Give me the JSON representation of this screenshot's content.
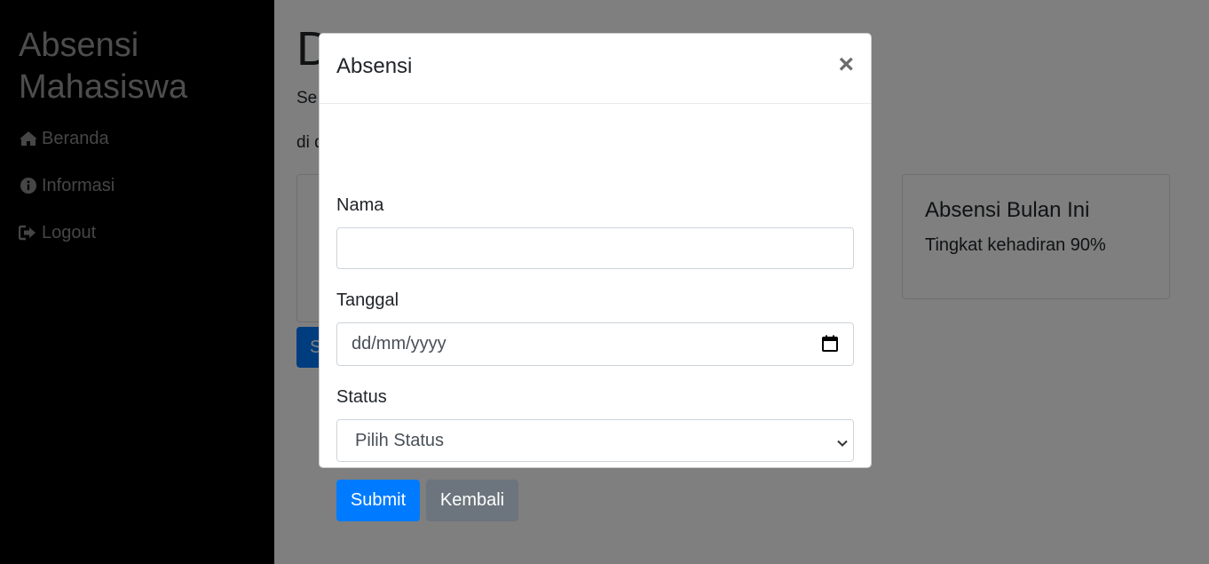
{
  "sidebar": {
    "brand": "Absensi Mahasiswa",
    "items": [
      {
        "label": "Beranda",
        "icon": "home-icon"
      },
      {
        "label": "Informasi",
        "icon": "info-circle-icon"
      },
      {
        "label": "Logout",
        "icon": "sign-out-icon"
      }
    ]
  },
  "main": {
    "title_visible": "D",
    "line1_visible": "Se",
    "line2_visible": "di d",
    "button_visible": "S",
    "card_right": {
      "title": "Absensi Bulan Ini",
      "text": "Tingkat kehadiran 90%"
    }
  },
  "modal": {
    "title": "Absensi",
    "close_symbol": "×",
    "fields": {
      "nama": {
        "label": "Nama",
        "value": ""
      },
      "tanggal": {
        "label": "Tanggal",
        "placeholder": "dd/mm/yyyy"
      },
      "status": {
        "label": "Status",
        "selected": "Pilih Status"
      }
    },
    "buttons": {
      "submit": "Submit",
      "kembali": "Kembali"
    }
  },
  "colors": {
    "sidebar_bg": "#000000",
    "primary": "#007bff",
    "secondary": "#6c757d",
    "backdrop": "rgba(0,0,0,0.5)"
  }
}
